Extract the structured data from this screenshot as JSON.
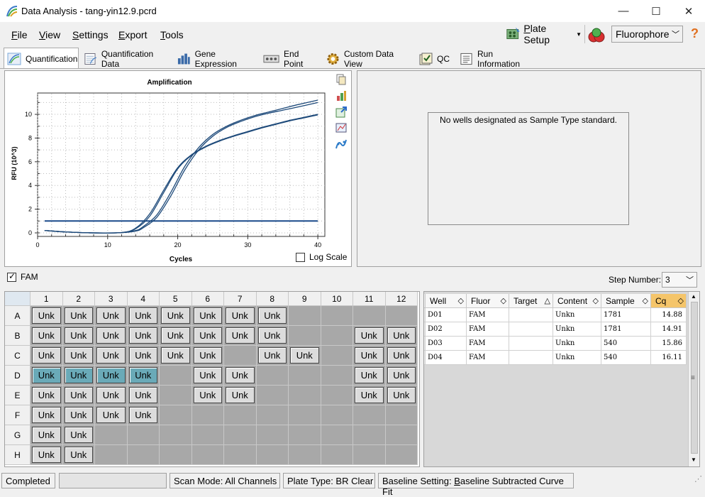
{
  "window": {
    "title": "Data Analysis - tang-yin12.9.pcrd",
    "minimize": "—",
    "maximize": "☐",
    "close": "✕"
  },
  "menu": [
    {
      "key": "F",
      "rest": "ile"
    },
    {
      "key": "V",
      "rest": "iew"
    },
    {
      "key": "S",
      "rest": "ettings"
    },
    {
      "key": "E",
      "rest": "xport"
    },
    {
      "key": "T",
      "rest": "ools"
    }
  ],
  "toolbar": {
    "plate_setup_key": "P",
    "plate_setup_rest": "late Setup",
    "fluorophore": "Fluorophore",
    "help": "?"
  },
  "tabs": [
    {
      "label": "Quantification",
      "icon": "amplification-icon",
      "color": "#7aa8d8"
    },
    {
      "label": "Quantification Data",
      "icon": "data-sheet-icon",
      "color": "#9ab0c8"
    },
    {
      "label": "Gene Expression",
      "icon": "bar-chart-icon",
      "color": "#3a6aa8"
    },
    {
      "label": "End Point",
      "icon": "endpoint-icon",
      "color": "#888888"
    },
    {
      "label": "Custom Data View",
      "icon": "gear-icon",
      "color": "#d8a030"
    },
    {
      "label": "QC",
      "icon": "qc-check-icon",
      "color": "#a0a060"
    },
    {
      "label": "Run Information",
      "icon": "run-info-icon",
      "color": "#707070"
    }
  ],
  "chart_data": {
    "type": "line",
    "title": "Amplification",
    "xlabel": "Cycles",
    "ylabel": "RFU (10^3)",
    "xlim": [
      0,
      41
    ],
    "ylim": [
      -0.3,
      11.8
    ],
    "xticks": [
      0,
      10,
      20,
      30,
      40
    ],
    "yticks": [
      0,
      2,
      4,
      6,
      8,
      10
    ],
    "threshold": 1.0,
    "series": [
      {
        "x": [
          1,
          4,
          8,
          12,
          14,
          16,
          18,
          20,
          22,
          24,
          26,
          28,
          30,
          32,
          34,
          36,
          38,
          40
        ],
        "y": [
          0.2,
          0.08,
          0.0,
          0.03,
          0.4,
          1.6,
          3.6,
          5.5,
          6.6,
          7.3,
          7.8,
          8.2,
          8.55,
          8.9,
          9.2,
          9.5,
          9.75,
          10.0
        ]
      },
      {
        "x": [
          1,
          4,
          8,
          12,
          14,
          16,
          18,
          20,
          22,
          24,
          26,
          28,
          30,
          32,
          34,
          36,
          38,
          40
        ],
        "y": [
          0.2,
          0.08,
          0.0,
          0.03,
          0.35,
          1.4,
          3.4,
          5.4,
          6.55,
          7.25,
          7.75,
          8.15,
          8.5,
          8.85,
          9.15,
          9.45,
          9.7,
          9.95
        ]
      },
      {
        "x": [
          1,
          4,
          8,
          12,
          14,
          15,
          17,
          19,
          21,
          23,
          25,
          27,
          29,
          31,
          33,
          35,
          37,
          40
        ],
        "y": [
          0.2,
          0.08,
          0.0,
          0.02,
          0.2,
          0.5,
          1.5,
          3.4,
          5.6,
          7.2,
          8.3,
          9.0,
          9.5,
          9.9,
          10.2,
          10.5,
          10.8,
          11.2
        ]
      },
      {
        "x": [
          1,
          4,
          8,
          12,
          14,
          15,
          17,
          19,
          21,
          23,
          25,
          27,
          29,
          31,
          33,
          35,
          37,
          40
        ],
        "y": [
          0.2,
          0.08,
          0.0,
          0.02,
          0.15,
          0.4,
          1.3,
          3.1,
          5.3,
          7.0,
          8.15,
          8.9,
          9.4,
          9.8,
          10.1,
          10.35,
          10.6,
          11.0
        ]
      }
    ],
    "log_scale_label": "Log Scale",
    "log_scale_checked": false
  },
  "standards_message": "No wells designated as Sample Type standard.",
  "fluor_filter": {
    "label": "FAM",
    "checked": true
  },
  "step": {
    "label": "Step Number:",
    "value": "3"
  },
  "plate": {
    "columns": [
      "1",
      "2",
      "3",
      "4",
      "5",
      "6",
      "7",
      "8",
      "9",
      "10",
      "11",
      "12"
    ],
    "rows": [
      {
        "label": "A",
        "wells": [
          "Unk",
          "Unk",
          "Unk",
          "Unk",
          "Unk",
          "Unk",
          "Unk",
          "Unk",
          "",
          "",
          "",
          ""
        ]
      },
      {
        "label": "B",
        "wells": [
          "Unk",
          "Unk",
          "Unk",
          "Unk",
          "Unk",
          "Unk",
          "Unk",
          "Unk",
          "",
          "",
          "Unk",
          "Unk"
        ]
      },
      {
        "label": "C",
        "wells": [
          "Unk",
          "Unk",
          "Unk",
          "Unk",
          "Unk",
          "Unk",
          "",
          "Unk",
          "Unk",
          "",
          "Unk",
          "Unk"
        ]
      },
      {
        "label": "D",
        "wells": [
          "Unk",
          "Unk",
          "Unk",
          "Unk",
          "",
          "Unk",
          "Unk",
          "",
          "",
          "",
          "Unk",
          "Unk"
        ],
        "selected": [
          0,
          1,
          2,
          3
        ]
      },
      {
        "label": "E",
        "wells": [
          "Unk",
          "Unk",
          "Unk",
          "Unk",
          "",
          "Unk",
          "Unk",
          "",
          "",
          "",
          "Unk",
          "Unk"
        ]
      },
      {
        "label": "F",
        "wells": [
          "Unk",
          "Unk",
          "Unk",
          "Unk",
          "",
          "",
          "",
          "",
          "",
          "",
          "",
          ""
        ]
      },
      {
        "label": "G",
        "wells": [
          "Unk",
          "Unk",
          "",
          "",
          "",
          "",
          "",
          "",
          "",
          "",
          "",
          ""
        ]
      },
      {
        "label": "H",
        "wells": [
          "Unk",
          "Unk",
          "",
          "",
          "",
          "",
          "",
          "",
          "",
          "",
          "",
          ""
        ]
      }
    ]
  },
  "results_table": {
    "columns": [
      "Well",
      "Fluor",
      "Target",
      "Content",
      "Sample",
      "Cq"
    ],
    "sort_icons": [
      "◇",
      "◇",
      "△",
      "◇",
      "◇",
      "◇"
    ],
    "rows": [
      [
        "D01",
        "FAM",
        "",
        "Unkn",
        "1781",
        "14.88"
      ],
      [
        "D02",
        "FAM",
        "",
        "Unkn",
        "1781",
        "14.91"
      ],
      [
        "D03",
        "FAM",
        "",
        "Unkn",
        "540",
        "15.86"
      ],
      [
        "D04",
        "FAM",
        "",
        "Unkn",
        "540",
        "16.11"
      ]
    ]
  },
  "status": {
    "state": "Completed",
    "scan_mode": "Scan Mode: All Channels",
    "plate_type": "Plate Type: BR Clear",
    "baseline_prefix": "Baseline Setting: ",
    "baseline_key": "B",
    "baseline_rest": "aseline Subtracted Curve Fit"
  }
}
